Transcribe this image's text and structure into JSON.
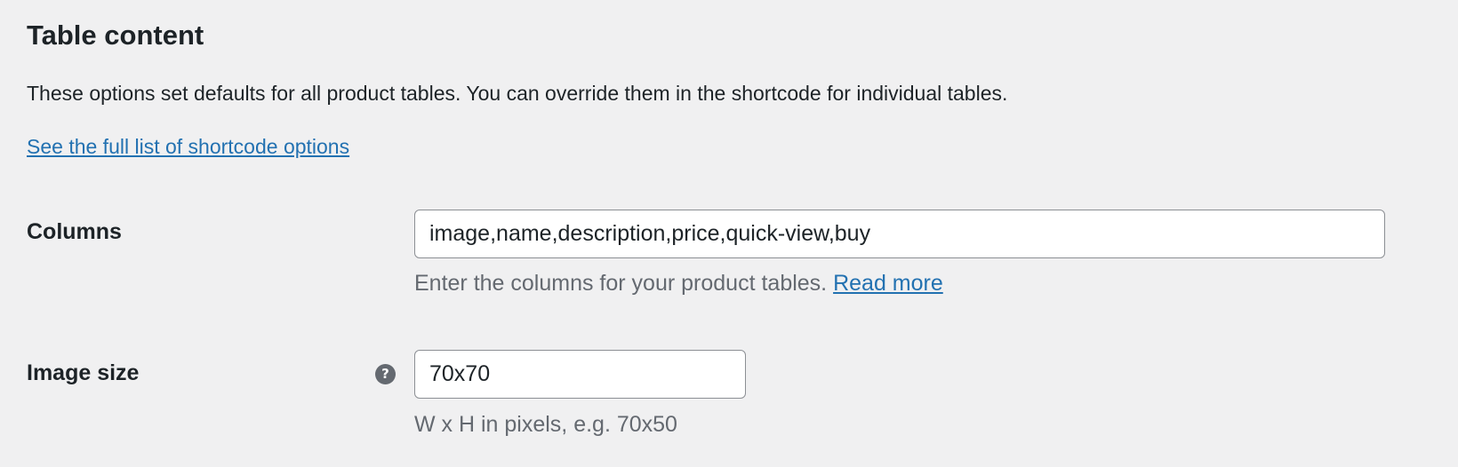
{
  "section": {
    "title": "Table content",
    "description": "These options set defaults for all product tables. You can override them in the shortcode for individual tables.",
    "shortcode_link": "See the full list of shortcode options"
  },
  "columns_row": {
    "label": "Columns",
    "value": "image,name,description,price,quick-view,buy",
    "description": "Enter the columns for your product tables.",
    "read_more": "Read more"
  },
  "image_size_row": {
    "label": "Image size",
    "help_icon": "question-circle-icon",
    "help_glyph": "?",
    "value": "70x70",
    "description": "W x H in pixels, e.g. 70x50"
  },
  "colors": {
    "background": "#f0f0f1",
    "text": "#1d2327",
    "muted_text": "#646970",
    "link": "#2271b1",
    "input_border": "#8c8f94"
  }
}
